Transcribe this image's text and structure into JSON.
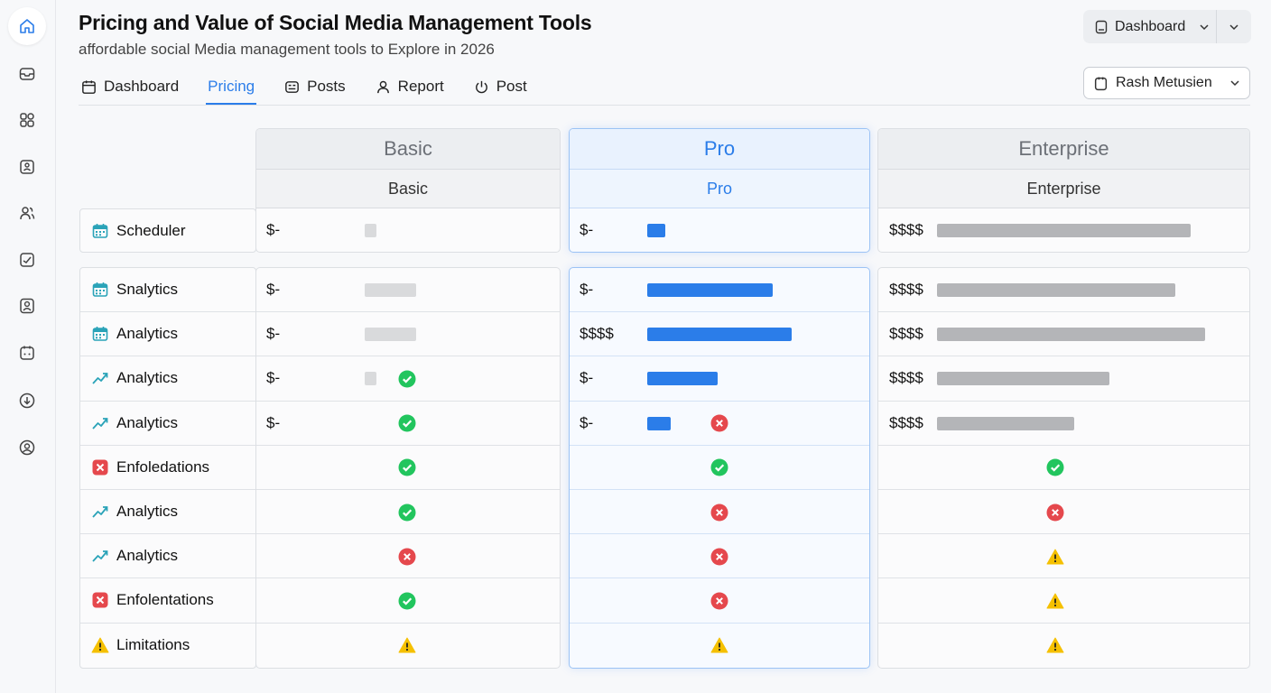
{
  "header": {
    "title": "Pricing and Value of Social Media Management Tools",
    "subtitle": "affordable social Media management tools to Explore in 2026"
  },
  "top_dropdown": {
    "label": "Dashboard"
  },
  "user_dropdown": {
    "label": "Rash Metusien"
  },
  "tabs": [
    {
      "label": "Dashboard",
      "icon": "calendar-icon",
      "active": false
    },
    {
      "label": "Pricing",
      "icon": "",
      "active": true
    },
    {
      "label": "Posts",
      "icon": "posts-icon",
      "active": false
    },
    {
      "label": "Report",
      "icon": "user-icon",
      "active": false
    },
    {
      "label": "Post",
      "icon": "power-icon",
      "active": false
    }
  ],
  "sidebar": {
    "items": [
      {
        "icon": "home-icon",
        "active": true
      },
      {
        "icon": "inbox-icon",
        "active": false
      },
      {
        "icon": "apps-icon",
        "active": false
      },
      {
        "icon": "contact-card-icon",
        "active": false
      },
      {
        "icon": "people-icon",
        "active": false
      },
      {
        "icon": "chart-box-icon",
        "active": false
      },
      {
        "icon": "profile-icon",
        "active": false
      },
      {
        "icon": "calendar-icon",
        "active": false
      },
      {
        "icon": "download-icon",
        "active": false
      },
      {
        "icon": "account-icon",
        "active": false
      }
    ]
  },
  "colors": {
    "accent": "#2b7de9",
    "check": "#22c55e",
    "cross": "#e5484d",
    "warning": "#f5c000"
  },
  "table": {
    "plans": [
      {
        "name": "Basic",
        "subname": "Basic"
      },
      {
        "name": "Pro",
        "subname": "Pro"
      },
      {
        "name": "Enterprise",
        "subname": "Enterprise"
      }
    ],
    "top_rows": [
      {
        "feature": "Scheduler",
        "icon": "calendar-icon",
        "cells": [
          {
            "price": "$-",
            "bar": 0.07
          },
          {
            "price": "$-",
            "bar": 0.07
          },
          {
            "price": "$$$$",
            "bar": 0.85
          }
        ]
      }
    ],
    "rows": [
      {
        "feature": "Snalytics",
        "icon": "calendar-icon",
        "cells": [
          {
            "price": "$-",
            "bar": 0.3
          },
          {
            "price": "$-",
            "bar": 0.48
          },
          {
            "price": "$$$$",
            "bar": 0.8
          }
        ]
      },
      {
        "feature": "Analytics",
        "icon": "calendar-icon",
        "cells": [
          {
            "price": "$-",
            "bar": 0.3
          },
          {
            "price": "$$$$",
            "bar": 0.55
          },
          {
            "price": "$$$$",
            "bar": 0.9
          }
        ]
      },
      {
        "feature": "Analytics",
        "icon": "trend-icon",
        "cells": [
          {
            "price": "$-",
            "bar": 0.07,
            "status": "check"
          },
          {
            "price": "$-",
            "bar": 0.27
          },
          {
            "price": "$$$$",
            "bar": 0.58
          }
        ]
      },
      {
        "feature": "Analytics",
        "icon": "trend-icon",
        "cells": [
          {
            "price": "$-",
            "status": "check"
          },
          {
            "price": "$-",
            "bar": 0.09,
            "status": "cross"
          },
          {
            "price": "$$$$",
            "bar": 0.46
          }
        ]
      },
      {
        "feature": "Enfoledations",
        "icon": "x-box-icon",
        "cells": [
          {
            "status": "check"
          },
          {
            "status": "check"
          },
          {
            "status": "check"
          }
        ]
      },
      {
        "feature": "Analytics",
        "icon": "trend-icon",
        "cells": [
          {
            "status": "check"
          },
          {
            "status": "cross"
          },
          {
            "status": "cross"
          }
        ]
      },
      {
        "feature": "Analytics",
        "icon": "trend-icon",
        "cells": [
          {
            "status": "cross"
          },
          {
            "status": "cross"
          },
          {
            "status": "warning"
          }
        ]
      },
      {
        "feature": "Enfolentations",
        "icon": "x-box-icon",
        "cells": [
          {
            "status": "check"
          },
          {
            "status": "cross"
          },
          {
            "status": "warning"
          }
        ]
      },
      {
        "feature": "Limitations",
        "icon": "warning-icon",
        "cells": [
          {
            "status": "warning"
          },
          {
            "status": "warning"
          },
          {
            "status": "warning"
          }
        ]
      }
    ]
  }
}
